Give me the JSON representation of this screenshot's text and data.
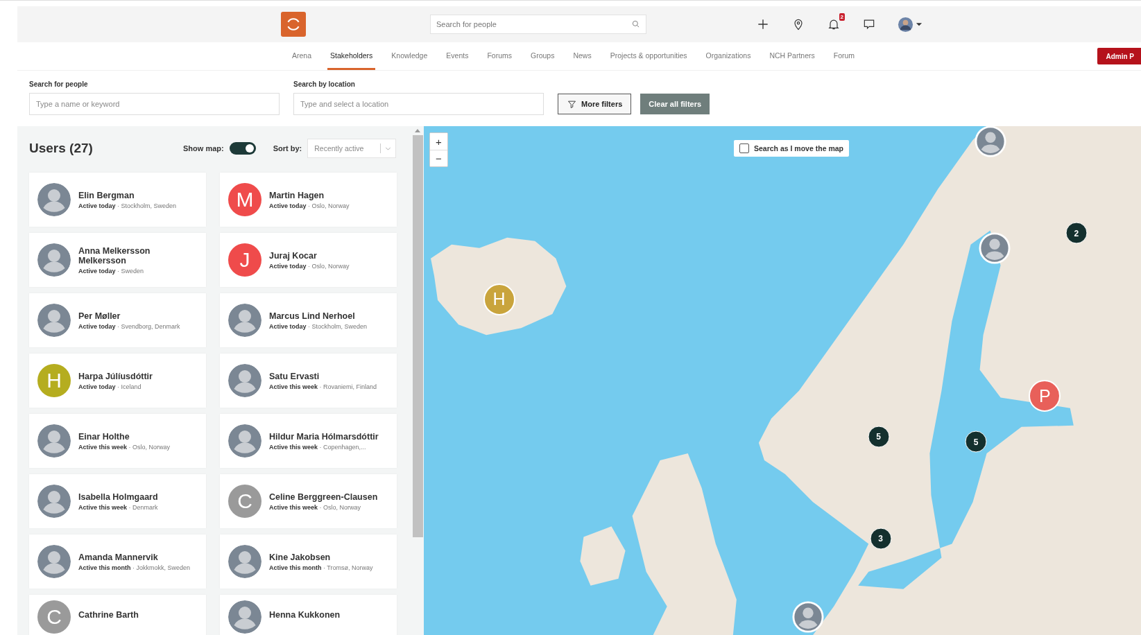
{
  "header": {
    "search": {
      "placeholder": "Search for people"
    },
    "notification_count": "2",
    "admin_button": "Admin P"
  },
  "nav": {
    "items": [
      {
        "label": "Arena",
        "selected": false
      },
      {
        "label": "Stakeholders",
        "selected": true
      },
      {
        "label": "Knowledge",
        "selected": false
      },
      {
        "label": "Events",
        "selected": false
      },
      {
        "label": "Forums",
        "selected": false
      },
      {
        "label": "Groups",
        "selected": false
      },
      {
        "label": "News",
        "selected": false
      },
      {
        "label": "Projects & opportunities",
        "selected": false
      },
      {
        "label": "Organizations",
        "selected": false
      },
      {
        "label": "NCH Partners",
        "selected": false
      },
      {
        "label": "Forum",
        "selected": false
      }
    ]
  },
  "filters": {
    "people": {
      "label": "Search for people",
      "placeholder": "Type a name or keyword"
    },
    "location": {
      "label": "Search by location",
      "placeholder": "Type and select a location"
    },
    "more_filters": "More filters",
    "clear_filters": "Clear all filters"
  },
  "users": {
    "title": "Users (27)",
    "show_map": {
      "label": "Show map:",
      "on": true
    },
    "sort": {
      "label": "Sort by:",
      "value": "Recently active"
    },
    "cards": [
      {
        "name": "Elin Bergman",
        "status": "**Active today** · Stockholm, Sweden",
        "avatar": {
          "kind": "photo"
        }
      },
      {
        "name": "Martin Hagen",
        "status": "**Active today** · Oslo, Norway",
        "avatar": {
          "kind": "letter",
          "letter": "M",
          "color": "#ef4b4b"
        }
      },
      {
        "name": "Anna Melkersson Melkersson",
        "status": "**Active today** · Sweden",
        "avatar": {
          "kind": "photo"
        }
      },
      {
        "name": "Juraj Kocar",
        "status": "**Active today** · Oslo, Norway",
        "avatar": {
          "kind": "letter",
          "letter": "J",
          "color": "#ef4b4b"
        }
      },
      {
        "name": "Per Møller",
        "status": "**Active today** · Svendborg, Denmark",
        "avatar": {
          "kind": "photo"
        }
      },
      {
        "name": "Marcus Lind Nerhoel",
        "status": "**Active today** · Stockholm, Sweden",
        "avatar": {
          "kind": "photo"
        }
      },
      {
        "name": "Harpa Júlíusdóttir",
        "status": "**Active today** · Iceland",
        "avatar": {
          "kind": "letter",
          "letter": "H",
          "color": "#b5ad1f"
        }
      },
      {
        "name": "Satu Ervasti",
        "status": "**Active this week** · Rovaniemi, Finland",
        "avatar": {
          "kind": "photo"
        }
      },
      {
        "name": "Einar Holthe",
        "status": "**Active this week** · Oslo, Norway",
        "avatar": {
          "kind": "photo"
        }
      },
      {
        "name": "Hildur Maria Hólmarsdóttir",
        "status": "**Active this week** · Copenhagen,...",
        "avatar": {
          "kind": "photo"
        }
      },
      {
        "name": "Isabella Holmgaard",
        "status": "**Active this week** · Denmark",
        "avatar": {
          "kind": "photo"
        }
      },
      {
        "name": "Celine Berggreen-Clausen",
        "status": "**Active this week** · Oslo, Norway",
        "avatar": {
          "kind": "letter",
          "letter": "C",
          "color": "#9a9a9a"
        }
      },
      {
        "name": "Amanda Mannervik",
        "status": "**Active this month** · Jokkmokk, Sweden",
        "avatar": {
          "kind": "photo"
        }
      },
      {
        "name": "Kine Jakobsen",
        "status": "**Active this month** · Tromsø, Norway",
        "avatar": {
          "kind": "photo"
        }
      },
      {
        "name": "Cathrine Barth",
        "avatar": {
          "kind": "letter",
          "letter": "C",
          "color": "#9a9a9a"
        }
      },
      {
        "name": "Henna Kukkonen",
        "avatar": {
          "kind": "photo"
        }
      }
    ]
  },
  "map": {
    "search_as_move": {
      "label": "Search as I move the map",
      "checked": false
    },
    "zoom_in": "+",
    "zoom_out": "−",
    "markers": [
      {
        "kind": "photo"
      },
      {
        "kind": "photo"
      },
      {
        "kind": "cluster",
        "count": "2"
      },
      {
        "kind": "letter",
        "letter": "H",
        "color": "#c9a43c"
      },
      {
        "kind": "letter",
        "letter": "P",
        "color": "#e8605a"
      },
      {
        "kind": "cluster",
        "count": "5"
      },
      {
        "kind": "cluster",
        "count": "5"
      },
      {
        "kind": "cluster",
        "count": "3"
      },
      {
        "kind": "photo"
      }
    ]
  }
}
